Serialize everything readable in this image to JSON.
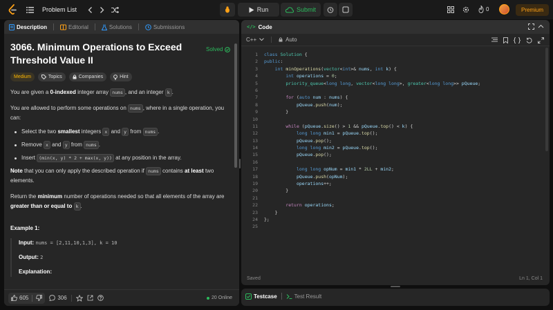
{
  "topbar": {
    "problem_list_label": "Problem List",
    "run_label": "Run",
    "submit_label": "Submit",
    "streak_count": "0",
    "premium_label": "Premium"
  },
  "left_tabs": [
    {
      "label": "Description"
    },
    {
      "label": "Editorial"
    },
    {
      "label": "Solutions"
    },
    {
      "label": "Submissions"
    }
  ],
  "problem": {
    "title": "3066. Minimum Operations to Exceed Threshold Value II",
    "solved_label": "Solved",
    "difficulty": "Medium",
    "topics_label": "Topics",
    "companies_label": "Companies",
    "hint_label": "Hint",
    "p1_a": "You are given a ",
    "p1_b": "0-indexed",
    "p1_c": " integer array ",
    "p1_nums": "nums",
    "p1_d": ", and an integer ",
    "p1_k": "k",
    "p1_e": ".",
    "p2_a": "You are allowed to perform some operations on ",
    "p2_nums": "nums",
    "p2_b": ", where in a single operation, you can:",
    "b1_a": "Select the two ",
    "b1_b": "smallest",
    "b1_c": " integers ",
    "b1_x": "x",
    "b1_d": " and ",
    "b1_y": "y",
    "b1_e": " from ",
    "b1_nums": "nums",
    "b1_f": ".",
    "b2_a": "Remove ",
    "b2_x": "x",
    "b2_b": " and ",
    "b2_y": "y",
    "b2_c": " from ",
    "b2_nums": "nums",
    "b2_d": ".",
    "b3_a": "Insert ",
    "b3_code": "(min(x, y) * 2 + max(x, y))",
    "b3_b": " at any position in the array.",
    "note_a": "Note",
    "note_b": " that you can only apply the described operation if ",
    "note_nums": "nums",
    "note_c": " contains ",
    "note_d": "at least",
    "note_e": " two elements.",
    "ret_a": "Return the ",
    "ret_b": "minimum",
    "ret_c": " number of operations needed so that all elements of the array are ",
    "ret_d": "greater than or equal to",
    "ret_e": " ",
    "ret_k": "k",
    "ret_f": ".",
    "example_title": "Example 1:",
    "input_label": "Input:",
    "input_value": "nums = [2,11,10,1,3], k = 10",
    "output_label": "Output:",
    "output_value": "2",
    "explanation_label": "Explanation:"
  },
  "footer": {
    "likes": "605",
    "comments": "306",
    "online": "20 Online"
  },
  "code_panel": {
    "title": "Code",
    "language": "C++",
    "auto_label": "Auto",
    "status_left": "Saved",
    "status_right": "Ln 1, Col 1"
  },
  "bottom_tabs": [
    {
      "label": "Testcase"
    },
    {
      "label": "Test Result"
    }
  ],
  "code_lines": [
    "class Solution {",
    "public:",
    "    int minOperations(vector<int>& nums, int k) {",
    "        int operations = 0;",
    "        priority_queue<long long, vector<long long>, greater<long long>> pQueue;",
    "",
    "        for (auto num : nums) {",
    "            pQueue.push(num);",
    "        }",
    "",
    "        while (pQueue.size() > 1 && pQueue.top() < k) {",
    "            long long min1 = pQueue.top();",
    "            pQueue.pop();",
    "            long long min2 = pQueue.top();",
    "            pQueue.pop();",
    "",
    "            long long opNum = min1 * 2LL + min2;",
    "            pQueue.push(opNum);",
    "            operations++;",
    "        }",
    "",
    "        return operations;",
    "    }",
    "};",
    ""
  ],
  "colors": {
    "accent_orange": "#ffa116",
    "accent_green": "#2cbb5d",
    "medium_yellow": "#ffb800"
  }
}
